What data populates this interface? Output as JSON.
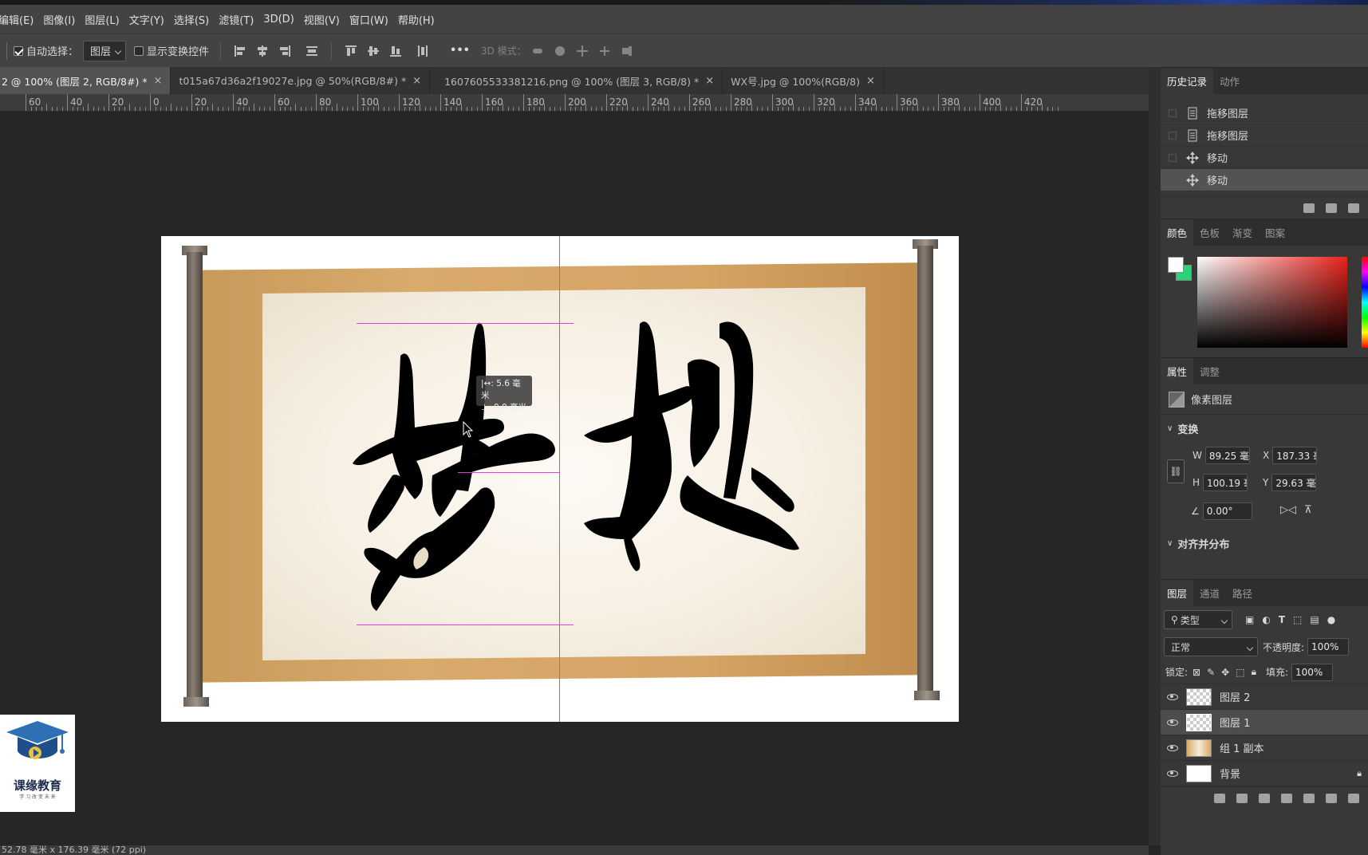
{
  "menu": [
    "编辑(E)",
    "图像(I)",
    "图层(L)",
    "文字(Y)",
    "选择(S)",
    "滤镜(T)",
    "3D(D)",
    "视图(V)",
    "窗口(W)",
    "帮助(H)"
  ],
  "options": {
    "auto_select_label": "自动选择：",
    "auto_select_value": "图层",
    "show_transform_label": "显示变换控件",
    "more": "•••",
    "mode_3d": "3D 模式："
  },
  "tabs": [
    {
      "label": "2 @ 100% (图层 2, RGB/8#) *",
      "active": true
    },
    {
      "label": "t015a67d36a2f19027e.jpg @ 50%(RGB/8#) *",
      "active": false
    },
    {
      "label": "1607605533381216.png @ 100% (图层 3, RGB/8) *",
      "active": false
    },
    {
      "label": "WX号.jpg @ 100%(RGB/8)",
      "active": false
    }
  ],
  "tab_close": "×",
  "ruler_labels": [
    "60",
    "40",
    "20",
    "0",
    "20",
    "40",
    "60",
    "80",
    "100",
    "120",
    "140",
    "160",
    "180",
    "200",
    "220",
    "240",
    "260",
    "280",
    "300",
    "320",
    "340",
    "360",
    "380",
    "400",
    "420"
  ],
  "canvas": {
    "measure_line1": "|↔: 5.6 毫米",
    "measure_line2": "⊥: 0.0 毫米",
    "calligraphy_char1": "梦",
    "calligraphy_char2": "想"
  },
  "logo": {
    "name": "课缘教育",
    "sub": "学 习 改 变 未 来"
  },
  "status": "52.78 毫米 x 176.39 毫米 (72 ppi)",
  "history": {
    "tabs": [
      "历史记录",
      "动作"
    ],
    "items": [
      {
        "label": "拖移图层",
        "icon": "document-icon"
      },
      {
        "label": "拖移图层",
        "icon": "document-icon"
      },
      {
        "label": "移动",
        "icon": "move-icon"
      },
      {
        "label": "移动",
        "icon": "move-icon",
        "selected": true
      }
    ]
  },
  "color": {
    "tabs": [
      "颜色",
      "色板",
      "渐变",
      "图案"
    ],
    "fg": "#ffffff",
    "bg": "#2ad37a"
  },
  "properties": {
    "tabs": [
      "属性",
      "调整"
    ],
    "kind": "像素图层",
    "transform_title": "变换",
    "w_label": "W",
    "w": "89.25 毫米",
    "x_label": "X",
    "x": "187.33 毫",
    "h_label": "H",
    "h": "100.19 毫",
    "y_label": "Y",
    "y": "29.63 毫米",
    "angle": "0.00°",
    "align_title": "对齐并分布"
  },
  "layers": {
    "tabs": [
      "图层",
      "通道",
      "路径"
    ],
    "filter": "类型",
    "blend": "正常",
    "opacity_label": "不透明度:",
    "opacity": "100%",
    "lock_label": "锁定:",
    "fill_label": "填充:",
    "fill": "100%",
    "items": [
      {
        "name": "图层 2",
        "thumb": "checker"
      },
      {
        "name": "图层 1",
        "thumb": "checker",
        "selected": true
      },
      {
        "name": "组 1 副本",
        "thumb": "paper"
      },
      {
        "name": "背景",
        "thumb": "white"
      }
    ]
  }
}
